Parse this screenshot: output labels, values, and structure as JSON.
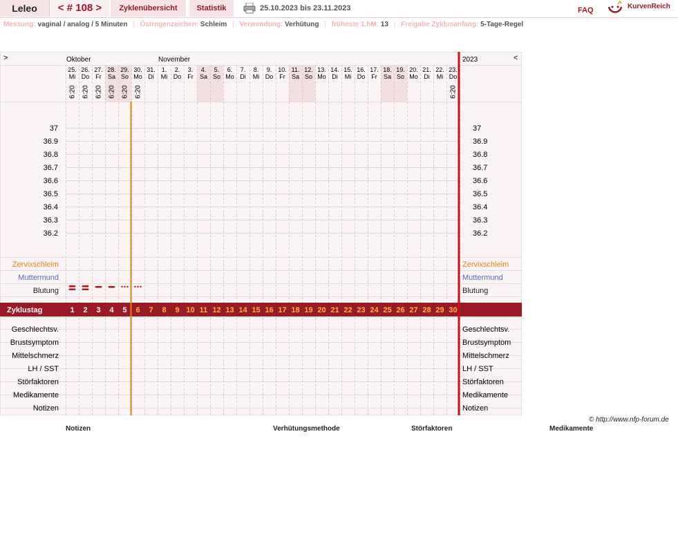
{
  "header": {
    "user_name": "Leleo",
    "cycle_label": "< # 108 >",
    "tabs": [
      {
        "label": "Zyklenübersicht"
      },
      {
        "label": "Statistik"
      }
    ],
    "date_range": "25.10.2023 bis 23.11.2023",
    "faq": "FAQ",
    "brand": "KurvenReich"
  },
  "info": {
    "items": [
      {
        "label": "Messung:",
        "value": "vaginal / analog / 5 Minuten"
      },
      {
        "label": "Östrogenzeichen:",
        "value": "Schleim"
      },
      {
        "label": "Verwendung:",
        "value": "Verhütung"
      },
      {
        "label": "früheste 1.hM:",
        "value": "13"
      },
      {
        "label": "Freigabe Zyklusanfang:",
        "value": "5-Tage-Regel"
      }
    ]
  },
  "chart_data": {
    "type": "line",
    "nav_prev": ">",
    "nav_next": "<",
    "year": "2023",
    "months": [
      {
        "label": "Oktober",
        "start_index": 0
      },
      {
        "label": "November",
        "start_index": 7
      }
    ],
    "days": [
      {
        "d": "25.",
        "w": "Mi",
        "t": "6:20"
      },
      {
        "d": "26.",
        "w": "Do",
        "t": "6:20"
      },
      {
        "d": "27.",
        "w": "Fr",
        "t": "6:20"
      },
      {
        "d": "28.",
        "w": "Sa",
        "t": "6:20"
      },
      {
        "d": "29.",
        "w": "So",
        "t": "6:20"
      },
      {
        "d": "30.",
        "w": "Mo",
        "t": "6:20"
      },
      {
        "d": "31.",
        "w": "Di",
        "t": ""
      },
      {
        "d": "1.",
        "w": "Mi",
        "t": ""
      },
      {
        "d": "2.",
        "w": "Do",
        "t": ""
      },
      {
        "d": "3.",
        "w": "Fr",
        "t": ""
      },
      {
        "d": "4.",
        "w": "Sa",
        "t": ""
      },
      {
        "d": "5.",
        "w": "So",
        "t": ""
      },
      {
        "d": "6.",
        "w": "Mo",
        "t": ""
      },
      {
        "d": "7.",
        "w": "Di",
        "t": ""
      },
      {
        "d": "8.",
        "w": "Mi",
        "t": ""
      },
      {
        "d": "9.",
        "w": "Do",
        "t": ""
      },
      {
        "d": "10.",
        "w": "Fr",
        "t": ""
      },
      {
        "d": "11.",
        "w": "Sa",
        "t": ""
      },
      {
        "d": "12.",
        "w": "So",
        "t": ""
      },
      {
        "d": "13.",
        "w": "Mo",
        "t": ""
      },
      {
        "d": "14.",
        "w": "Di",
        "t": ""
      },
      {
        "d": "15.",
        "w": "Mi",
        "t": ""
      },
      {
        "d": "16.",
        "w": "Do",
        "t": ""
      },
      {
        "d": "17.",
        "w": "Fr",
        "t": ""
      },
      {
        "d": "18.",
        "w": "Sa",
        "t": ""
      },
      {
        "d": "19.",
        "w": "So",
        "t": ""
      },
      {
        "d": "20.",
        "w": "Mo",
        "t": ""
      },
      {
        "d": "21.",
        "w": "Di",
        "t": ""
      },
      {
        "d": "22.",
        "w": "Mi",
        "t": ""
      },
      {
        "d": "23.",
        "w": "Do",
        "t": "6:20"
      }
    ],
    "weekend_indices": [
      3,
      4,
      10,
      11,
      17,
      18,
      24,
      25
    ],
    "y_ticks": [
      "37",
      "36.9",
      "36.8",
      "36.7",
      "36.6",
      "36.5",
      "36.4",
      "36.3",
      "36.2"
    ],
    "ylim": [
      36.2,
      37
    ],
    "series": [],
    "marker_day_index": 5,
    "rows_upper": [
      {
        "label": "Zervixschleim",
        "color": "#e8820c"
      },
      {
        "label": "Muttermund",
        "color": "#5566cc"
      },
      {
        "label": "Blutung",
        "color": "#222222"
      }
    ],
    "bleeding": [
      "strong",
      "strong",
      "medium",
      "medium",
      "light",
      "light"
    ],
    "cycle_row_label": "Zyklustag",
    "cycle_days": [
      "1",
      "2",
      "3",
      "4",
      "5",
      "6",
      "7",
      "8",
      "9",
      "10",
      "11",
      "12",
      "13",
      "14",
      "15",
      "16",
      "17",
      "18",
      "19",
      "20",
      "21",
      "22",
      "23",
      "24",
      "25",
      "26",
      "27",
      "28",
      "29",
      "30"
    ],
    "rows_lower": [
      "Geschlechtsv.",
      "Brustsymptom",
      "Mittelschmerz",
      "LH / SST",
      "Störfaktoren",
      "Medikamente",
      "Notizen"
    ],
    "colors": {
      "accent": "#9b1a26",
      "orange": "#e8820c",
      "grid": "#d9c8ca",
      "bg": "#fbf4f5"
    }
  },
  "footer": {
    "copyright": "© http://www.nfp-forum.de",
    "labels": [
      "Notizen",
      "Verhütungsmethode",
      "Störfaktoren",
      "Medikamente"
    ]
  }
}
